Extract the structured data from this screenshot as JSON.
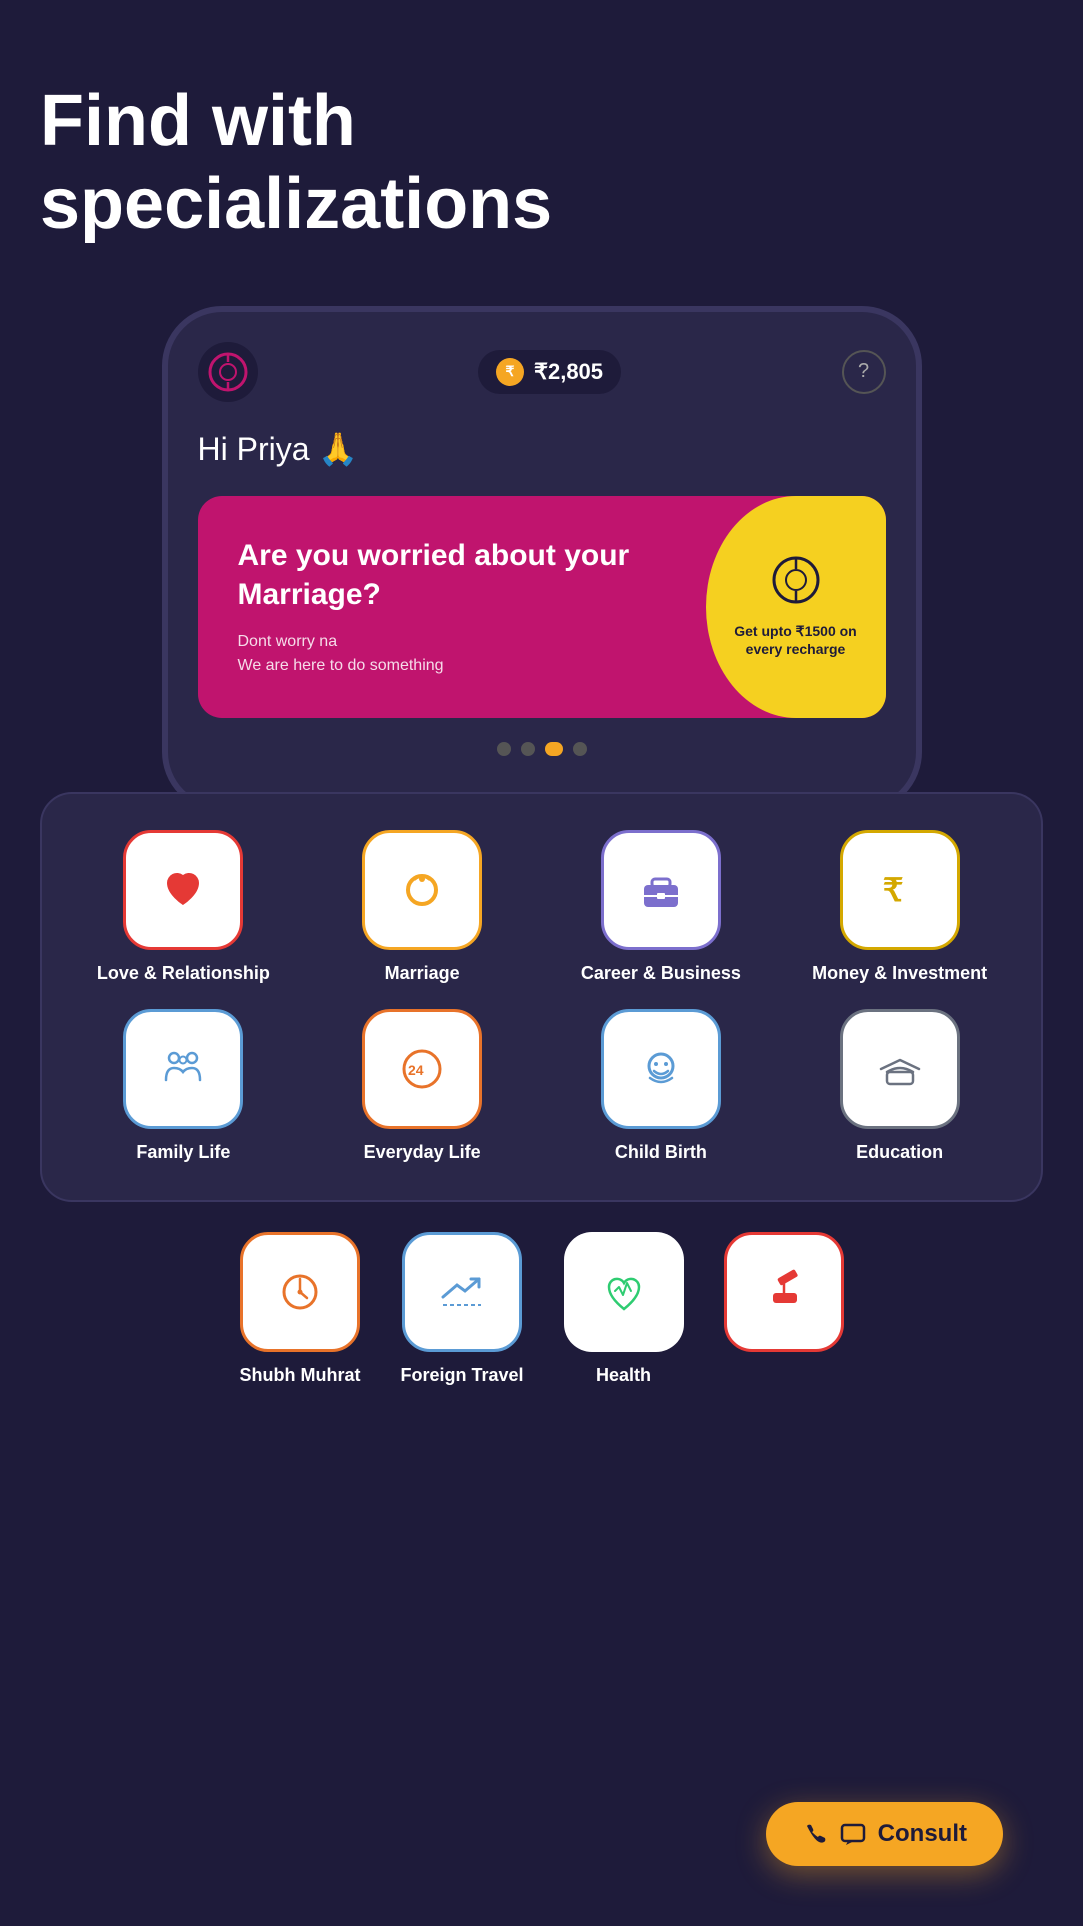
{
  "headline": "Find with specializations",
  "phone": {
    "coin_amount": "₹2,805",
    "greeting": "Hi Priya 🙏",
    "banner": {
      "title": "Are you worried about your Marriage?",
      "subtitle_line1": "Dont worry na",
      "subtitle_line2": "We are here to do something",
      "promo": "Get upto ₹1500 on every recharge"
    },
    "dots": [
      "",
      "",
      "",
      ""
    ],
    "active_dot": 2
  },
  "specializations": {
    "title": "Find with specializations",
    "items": [
      {
        "id": "love",
        "label": "Love & Relationship",
        "icon_type": "heart",
        "border_class": "love"
      },
      {
        "id": "marriage",
        "label": "Marriage",
        "icon_type": "ring",
        "border_class": "marriage"
      },
      {
        "id": "career",
        "label": "Career & Business",
        "icon_type": "briefcase",
        "border_class": "career"
      },
      {
        "id": "money",
        "label": "Money & Investment",
        "icon_type": "rupee",
        "border_class": "money"
      },
      {
        "id": "family",
        "label": "Family Life",
        "icon_type": "family",
        "border_class": "family"
      },
      {
        "id": "everyday",
        "label": "Everyday Life",
        "icon_type": "clock24",
        "border_class": "everyday"
      },
      {
        "id": "childbirth",
        "label": "Child Birth",
        "icon_type": "baby",
        "border_class": "childbirth"
      },
      {
        "id": "education",
        "label": "Education",
        "icon_type": "gradcap",
        "border_class": "education"
      }
    ],
    "bottom_items": [
      {
        "id": "shubh",
        "label": "Shubh Muhrat",
        "icon_type": "stopwatch",
        "border_class": "everyday"
      },
      {
        "id": "foreign",
        "label": "Foreign Travel",
        "icon_type": "flight",
        "border_class": "family"
      },
      {
        "id": "health",
        "label": "Healt...",
        "icon_type": "health",
        "border_class": "family"
      },
      {
        "id": "legal",
        "label": "",
        "icon_type": "hammer",
        "border_class": "love"
      }
    ]
  },
  "consult_button": {
    "label": "Consult"
  }
}
